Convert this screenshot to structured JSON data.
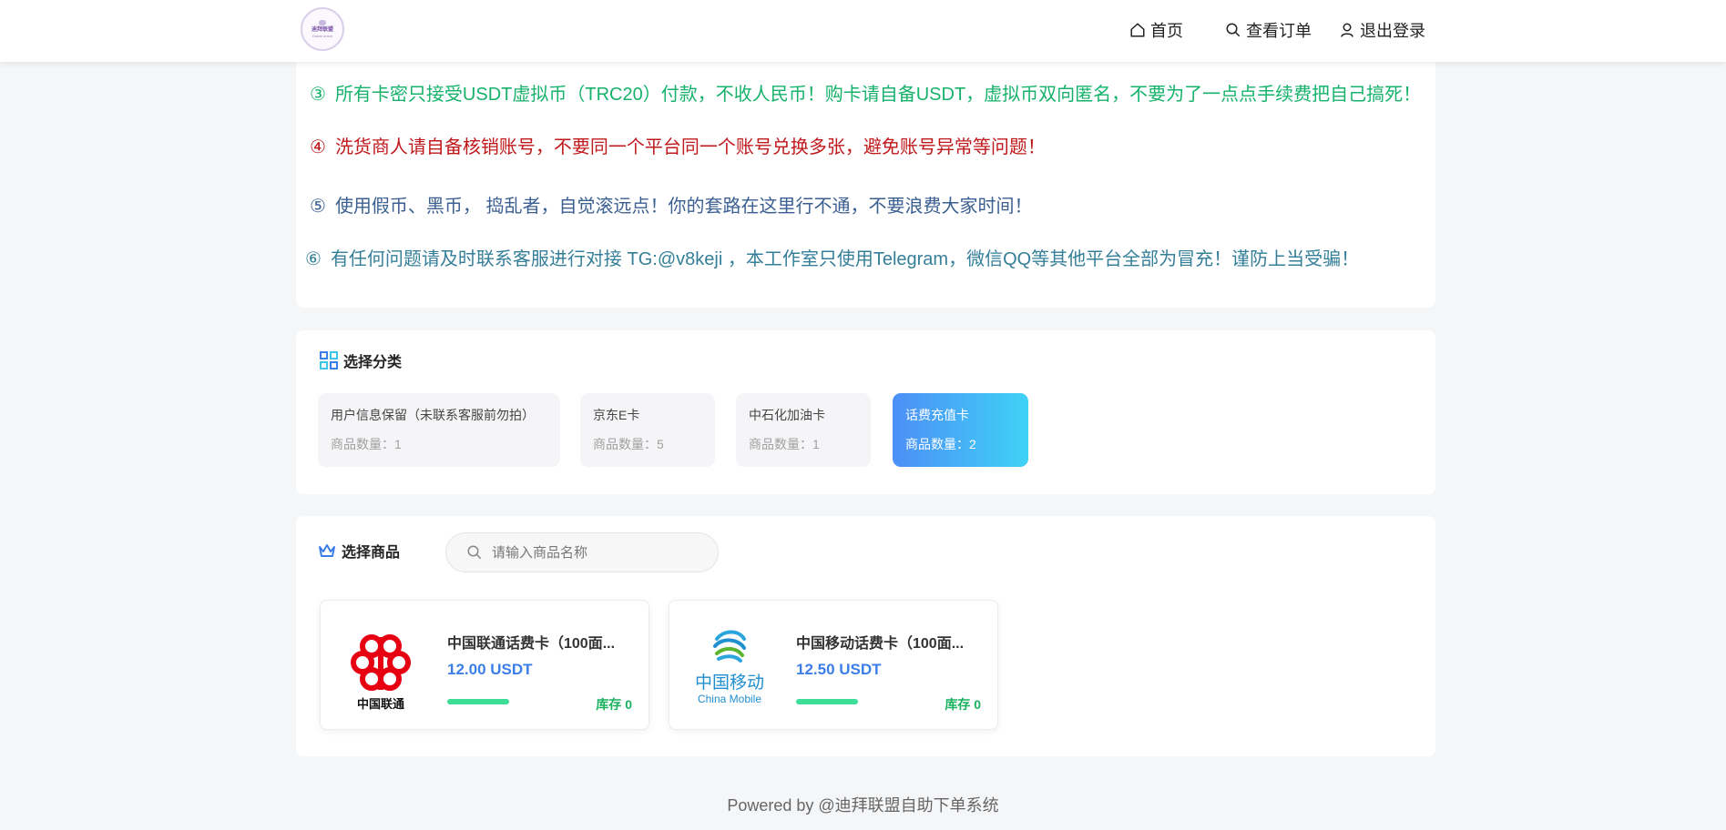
{
  "header": {
    "logo": {
      "title": "迪拜联盟",
      "subtitle": "Dubai Union"
    },
    "nav": {
      "home": "首页",
      "orders": "查看订单",
      "logout": "退出登录"
    }
  },
  "notices": [
    {
      "num": "③",
      "text": "所有卡密只接受USDT虚拟币（TRC20）付款，不收人民币！购卡请自备USDT，虚拟币双向匿名，不要为了一点点手续费把自己搞死！",
      "color": "#16b26b"
    },
    {
      "num": "④",
      "text": "洗货商人请自备核销账号，不要同一个平台同一个账号兑换多张，避免账号异常等问题！",
      "color": "#c0191c"
    },
    {
      "num": "⑤",
      "text": "使用假币、黑币， 捣乱者，自觉滚远点！你的套路在这里行不通，不要浪费大家时间！",
      "color": "#3b5f91"
    },
    {
      "num": "⑥",
      "text": "有任何问题请及时联系客服进行对接  TG:@v8keji ，本工作室只使用Telegram，微信QQ等其他平台全部为冒充！谨防上当受骗！",
      "color": "#357f99"
    }
  ],
  "category": {
    "title": "选择分类",
    "items": [
      {
        "name": "用户信息保留（未联系客服前勿拍）",
        "count": "商品数量：1",
        "active": false
      },
      {
        "name": "京东E卡",
        "count": "商品数量：5",
        "active": false
      },
      {
        "name": "中石化加油卡",
        "count": "商品数量：1",
        "active": false
      },
      {
        "name": "话费充值卡",
        "count": "商品数量：2",
        "active": true
      }
    ]
  },
  "goods": {
    "title": "选择商品",
    "search_placeholder": "请输入商品名称",
    "products": [
      {
        "name": "中国联通话费卡（100面...",
        "price": "12.00 USDT",
        "stock": "库存 0",
        "logo": "china-unicom-logo",
        "logo_text": "中国联通"
      },
      {
        "name": "中国移动话费卡（100面...",
        "price": "12.50 USDT",
        "stock": "库存 0",
        "logo": "china-mobile-logo",
        "logo_text": "中国移动",
        "logo_subtext": "China Mobile"
      }
    ]
  },
  "footer": {
    "text": "Powered by @迪拜联盟自助下单系统"
  },
  "colors": {
    "accent": "#3b7ee8",
    "stock_green": "#19b15f",
    "active_gradient_start": "#4d8ff7",
    "active_gradient_end": "#3ed2f5"
  }
}
